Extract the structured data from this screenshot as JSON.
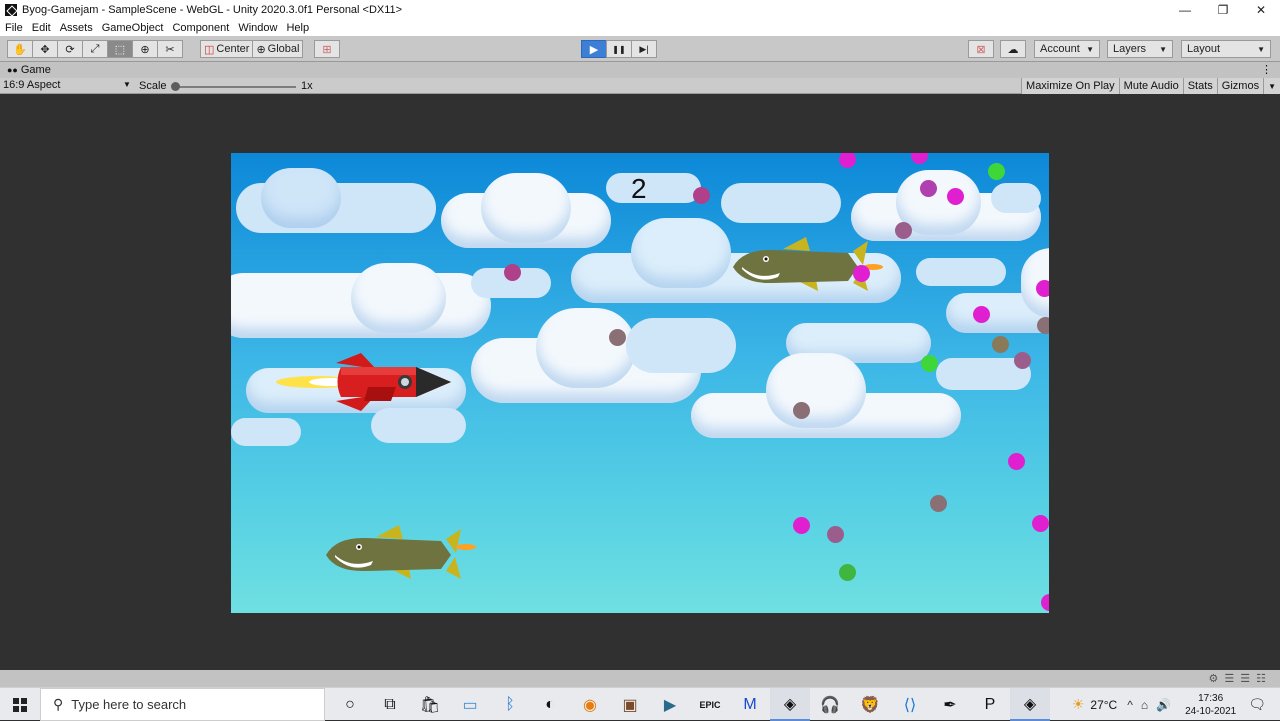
{
  "window": {
    "title": "Byog-Gamejam - SampleScene - WebGL - Unity 2020.3.0f1 Personal <DX11>",
    "controls": [
      "—",
      "❐",
      "✕"
    ]
  },
  "menu": [
    "File",
    "Edit",
    "Assets",
    "GameObject",
    "Component",
    "Window",
    "Help"
  ],
  "toolbar": {
    "tools": [
      "hand-icon",
      "move-icon",
      "rotate-icon",
      "scale-icon",
      "rect-icon",
      "transform-icon",
      "custom-tool-icon"
    ],
    "pivot_label": "Center",
    "space_label": "Global",
    "play": "▶",
    "pause": "❚❚",
    "step": "▶|",
    "account": "Account",
    "layers": "Layers",
    "layout": "Layout"
  },
  "tab": {
    "label": "Game"
  },
  "gamebar": {
    "aspect": "16:9 Aspect",
    "scale_label": "Scale",
    "scale_value": "1x",
    "buttons": [
      "Maximize On Play",
      "Mute Audio",
      "Stats",
      "Gizmos"
    ]
  },
  "game": {
    "score": "2"
  },
  "colors": {
    "magenta": "#e020d0",
    "faded_purple": "#9b5d8c",
    "grey_brown": "#8a6f74",
    "green": "#3fd63a",
    "sky_top": "#0c88d8",
    "sky_bottom": "#6fe0e2"
  },
  "taskbar": {
    "search_placeholder": "Type here to search",
    "apps": [
      "cortana-icon",
      "task-view-icon",
      "store-icon",
      "photos-icon",
      "bluetooth-icon",
      "unity-hub-icon",
      "blender-icon",
      "game-icon",
      "media-icon",
      "epic-games-icon",
      "malwarebytes-icon",
      "unity-icon",
      "headphones-icon",
      "brave-icon",
      "vscode-icon",
      "inkscape-icon",
      "app-p-icon",
      "unity-editor-icon"
    ],
    "temperature": "27°C",
    "time": "17:36",
    "date": "24-10-2021"
  }
}
